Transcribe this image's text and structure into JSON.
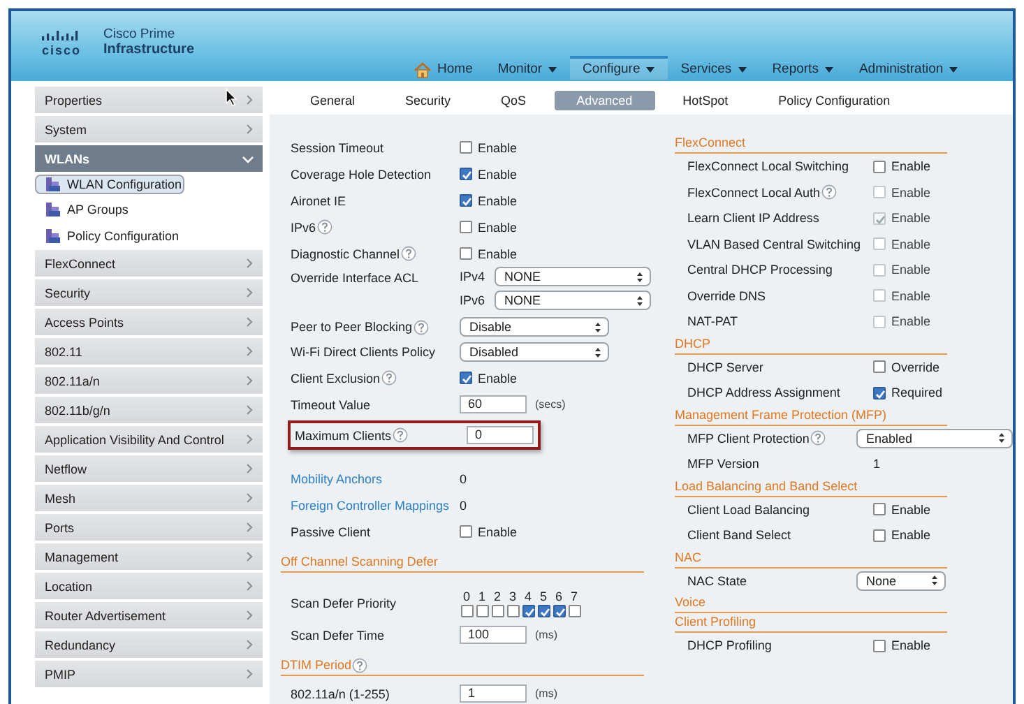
{
  "header": {
    "logo_text": "cisco",
    "product_line1": "Cisco Prime",
    "product_line2": "Infrastructure"
  },
  "nav": [
    {
      "label": "Home",
      "kind": "home",
      "dropdown": false,
      "selected": false
    },
    {
      "label": "Monitor",
      "kind": "menu",
      "dropdown": true,
      "selected": false
    },
    {
      "label": "Configure",
      "kind": "menu",
      "dropdown": true,
      "selected": true
    },
    {
      "label": "Services",
      "kind": "menu",
      "dropdown": true,
      "selected": false
    },
    {
      "label": "Reports",
      "kind": "menu",
      "dropdown": true,
      "selected": false
    },
    {
      "label": "Administration",
      "kind": "menu",
      "dropdown": true,
      "selected": false
    }
  ],
  "sidebar": [
    {
      "label": "Properties",
      "expanded": false,
      "selected": false
    },
    {
      "label": "System",
      "expanded": false,
      "selected": false
    },
    {
      "label": "WLANs",
      "expanded": true,
      "selected": false,
      "children": [
        {
          "label": "WLAN Configuration",
          "selected": true
        },
        {
          "label": "AP Groups",
          "selected": false
        },
        {
          "label": "Policy Configuration",
          "selected": false
        }
      ]
    },
    {
      "label": "FlexConnect",
      "expanded": false,
      "selected": false
    },
    {
      "label": "Security",
      "expanded": false,
      "selected": false
    },
    {
      "label": "Access Points",
      "expanded": false,
      "selected": false
    },
    {
      "label": "802.11",
      "expanded": false,
      "selected": false
    },
    {
      "label": "802.11a/n",
      "expanded": false,
      "selected": false
    },
    {
      "label": "802.11b/g/n",
      "expanded": false,
      "selected": false
    },
    {
      "label": "Application Visibility And Control",
      "expanded": false,
      "selected": false
    },
    {
      "label": "Netflow",
      "expanded": false,
      "selected": false
    },
    {
      "label": "Mesh",
      "expanded": false,
      "selected": false
    },
    {
      "label": "Ports",
      "expanded": false,
      "selected": false
    },
    {
      "label": "Management",
      "expanded": false,
      "selected": false
    },
    {
      "label": "Location",
      "expanded": false,
      "selected": false
    },
    {
      "label": "Router Advertisement",
      "expanded": false,
      "selected": false
    },
    {
      "label": "Redundancy",
      "expanded": false,
      "selected": false
    },
    {
      "label": "PMIP",
      "expanded": false,
      "selected": false
    }
  ],
  "tabs": [
    {
      "label": "General",
      "selected": false
    },
    {
      "label": "Security",
      "selected": false
    },
    {
      "label": "QoS",
      "selected": false
    },
    {
      "label": "Advanced",
      "selected": true
    },
    {
      "label": "HotSpot",
      "selected": false
    },
    {
      "label": "Policy Configuration",
      "selected": false
    }
  ],
  "left": [
    {
      "kind": "check",
      "label": "Session Timeout",
      "help": false,
      "checked": false,
      "disabled": false,
      "option": "Enable"
    },
    {
      "kind": "check",
      "label": "Coverage Hole Detection",
      "help": false,
      "checked": true,
      "disabled": false,
      "option": "Enable"
    },
    {
      "kind": "check",
      "label": "Aironet IE",
      "help": false,
      "checked": true,
      "disabled": false,
      "option": "Enable"
    },
    {
      "kind": "check",
      "label": "IPv6",
      "help": true,
      "checked": false,
      "disabled": false,
      "option": "Enable"
    },
    {
      "kind": "check",
      "label": "Diagnostic Channel",
      "help": true,
      "checked": false,
      "disabled": false,
      "option": "Enable"
    },
    {
      "kind": "acl",
      "label": "Override Interface ACL",
      "help": false,
      "selects": [
        {
          "prefix": "IPv4",
          "value": "NONE"
        },
        {
          "prefix": "IPv6",
          "value": "NONE"
        }
      ]
    },
    {
      "kind": "select",
      "label": "Peer to Peer Blocking",
      "help": true,
      "value": "Disable"
    },
    {
      "kind": "select",
      "label": "Wi-Fi Direct Clients Policy",
      "help": false,
      "value": "Disabled"
    },
    {
      "kind": "check",
      "label": "Client Exclusion",
      "help": true,
      "checked": true,
      "disabled": false,
      "option": "Enable"
    },
    {
      "kind": "input",
      "label": "Timeout Value",
      "help": false,
      "value": "60",
      "unit": "(secs)",
      "highlighted": false
    },
    {
      "kind": "input",
      "label": "Maximum Clients",
      "help": true,
      "value": "0",
      "highlighted": true
    },
    {
      "kind": "info",
      "label": "Mobility Anchors",
      "link": true,
      "value": "0"
    },
    {
      "kind": "info",
      "label": "Foreign Controller Mappings",
      "link": true,
      "value": "0"
    },
    {
      "kind": "check",
      "label": "Passive Client",
      "help": false,
      "checked": false,
      "disabled": false,
      "option": "Enable"
    },
    {
      "kind": "heading",
      "label": "Off Channel Scanning Defer",
      "help": false
    },
    {
      "kind": "priority",
      "label": "Scan Defer Priority",
      "levels": [
        {
          "label": "0",
          "checked": false
        },
        {
          "label": "1",
          "checked": false
        },
        {
          "label": "2",
          "checked": false
        },
        {
          "label": "3",
          "checked": false
        },
        {
          "label": "4",
          "checked": true
        },
        {
          "label": "5",
          "checked": true
        },
        {
          "label": "6",
          "checked": true
        },
        {
          "label": "7",
          "checked": false
        }
      ]
    },
    {
      "kind": "input",
      "label": "Scan Defer Time",
      "help": false,
      "value": "100",
      "unit": "(ms)",
      "highlighted": false
    },
    {
      "kind": "heading",
      "label": "DTIM Period",
      "help": true
    },
    {
      "kind": "input",
      "label": "802.11a/n (1-255)",
      "help": false,
      "value": "1",
      "unit": "(ms)",
      "highlighted": false
    }
  ],
  "right": [
    {
      "kind": "heading",
      "label": "FlexConnect",
      "help": false
    },
    {
      "kind": "check",
      "label": "FlexConnect Local Switching",
      "help": false,
      "checked": false,
      "disabled": false,
      "option": "Enable"
    },
    {
      "kind": "check",
      "label": "FlexConnect Local Auth",
      "help": true,
      "checked": false,
      "disabled": true,
      "option": "Enable"
    },
    {
      "kind": "check",
      "label": "Learn Client IP Address",
      "help": false,
      "checked": true,
      "disabled": true,
      "option": "Enable"
    },
    {
      "kind": "check",
      "label": "VLAN Based Central Switching",
      "help": false,
      "checked": false,
      "disabled": true,
      "option": "Enable"
    },
    {
      "kind": "check",
      "label": "Central DHCP Processing",
      "help": false,
      "checked": false,
      "disabled": true,
      "option": "Enable"
    },
    {
      "kind": "check",
      "label": "Override DNS",
      "help": false,
      "checked": false,
      "disabled": true,
      "option": "Enable"
    },
    {
      "kind": "check",
      "label": "NAT-PAT",
      "help": false,
      "checked": false,
      "disabled": true,
      "option": "Enable"
    },
    {
      "kind": "heading",
      "label": "DHCP",
      "help": false
    },
    {
      "kind": "check",
      "label": "DHCP Server",
      "help": false,
      "checked": false,
      "disabled": false,
      "option": "Override"
    },
    {
      "kind": "check",
      "label": "DHCP Address Assignment",
      "help": false,
      "checked": true,
      "disabled": false,
      "option": "Required"
    },
    {
      "kind": "heading",
      "label": "Management Frame Protection (MFP)",
      "help": false
    },
    {
      "kind": "select",
      "label": "MFP Client Protection",
      "help": true,
      "value": "Enabled",
      "wide": true
    },
    {
      "kind": "info",
      "label": "MFP Version",
      "link": false,
      "value": "1"
    },
    {
      "kind": "heading",
      "label": "Load Balancing and Band Select",
      "help": false
    },
    {
      "kind": "check",
      "label": "Client Load Balancing",
      "help": false,
      "checked": false,
      "disabled": false,
      "option": "Enable"
    },
    {
      "kind": "check",
      "label": "Client Band Select",
      "help": false,
      "checked": false,
      "disabled": false,
      "option": "Enable"
    },
    {
      "kind": "heading",
      "label": "NAC",
      "help": false
    },
    {
      "kind": "select",
      "label": "NAC State",
      "help": false,
      "value": "None",
      "wide": false
    },
    {
      "kind": "heading",
      "label": "Voice",
      "help": false
    },
    {
      "kind": "heading",
      "label": "Client Profiling",
      "help": false
    },
    {
      "kind": "check",
      "label": "DHCP Profiling",
      "help": false,
      "checked": false,
      "disabled": false,
      "option": "Enable"
    }
  ]
}
